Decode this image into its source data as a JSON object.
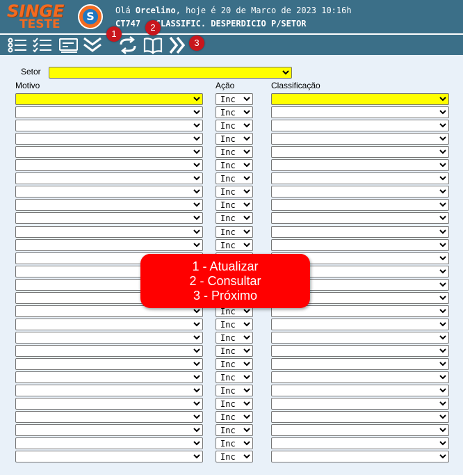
{
  "header": {
    "logo_top": "SINGE",
    "logo_bottom": "TESTE",
    "logo_mark": "S",
    "greeting_prefix": "Olá ",
    "user_name": "Orcelino",
    "greeting_suffix": ", hoje é 20 de Marco de 2023 10:16h",
    "screen_title": "CT747 - CLASSIFIC. DESPERDICIO P/SETOR",
    "colors": {
      "bar": "#3b6f88",
      "logo": "#f26b21"
    }
  },
  "toolbar": {
    "icons": [
      "list-icon",
      "checklist-icon",
      "card-icon",
      "double-chevron-down-icon",
      "refresh-icon",
      "book-icon",
      "double-chevron-right-icon"
    ],
    "badges": [
      "1",
      "2",
      "3"
    ]
  },
  "form": {
    "setor_label": "Setor",
    "setor_value": "",
    "motivo_header": "Motivo",
    "acao_header": "Ação",
    "classificacao_header": "Classificação",
    "acao_default": "Inc",
    "row_count": 28
  },
  "overlay": {
    "line1": "1 - Atualizar",
    "line2": "2 - Consultar",
    "line3": "3 - Próximo",
    "color": "#ff0000"
  }
}
